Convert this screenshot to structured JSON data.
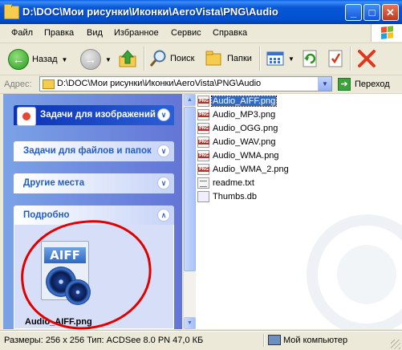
{
  "window": {
    "title": "D:\\DOC\\Мои рисунки\\Иконки\\AeroVista\\PNG\\Audio",
    "controls": [
      "_",
      "□",
      "✕"
    ]
  },
  "menu": [
    "Файл",
    "Правка",
    "Вид",
    "Избранное",
    "Сервис",
    "Справка"
  ],
  "toolbar": {
    "back_label": "Назад",
    "search_label": "Поиск",
    "folders_label": "Папки"
  },
  "address": {
    "label": "Адрес:",
    "value": "D:\\DOC\\Мои рисунки\\Иконки\\AeroVista\\PNG\\Audio",
    "go_label": "Переход"
  },
  "tasks": {
    "image_tasks": "Задачи для изображений",
    "file_tasks": "Задачи для файлов и папок",
    "other_places": "Другие места",
    "details": "Подробно",
    "preview_caption": "Audio_AIFF.png",
    "preview_badge": "AIFF"
  },
  "files": [
    {
      "name": "Audio_AIFF.png",
      "type": "png",
      "selected": true
    },
    {
      "name": "Audio_MP3.png",
      "type": "png",
      "selected": false
    },
    {
      "name": "Audio_OGG.png",
      "type": "png",
      "selected": false
    },
    {
      "name": "Audio_WAV.png",
      "type": "png",
      "selected": false
    },
    {
      "name": "Audio_WMA.png",
      "type": "png",
      "selected": false
    },
    {
      "name": "Audio_WMA_2.png",
      "type": "png",
      "selected": false
    },
    {
      "name": "readme.txt",
      "type": "txt",
      "selected": false
    },
    {
      "name": "Thumbs.db",
      "type": "db",
      "selected": false
    }
  ],
  "status": {
    "details": "Размеры: 256 x 256 Тип: ACDSee 8.0 PN 47,0 КБ",
    "location": "Мой компьютер"
  },
  "colors": {
    "titlebar": "#0050cf",
    "selection": "#316ac5",
    "annotation": "#e00000"
  }
}
